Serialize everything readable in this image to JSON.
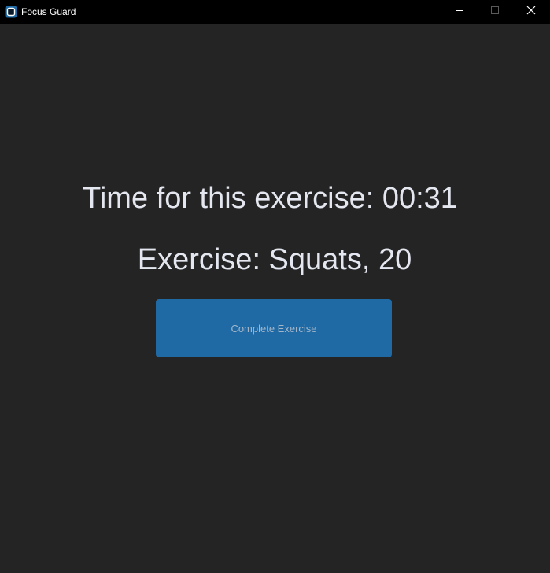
{
  "window": {
    "title": "Focus Guard",
    "app_icon": "focus-guard-app-icon",
    "controls": {
      "minimize_icon": "minimize-icon",
      "maximize_icon": "maximize-icon",
      "close_icon": "close-icon"
    }
  },
  "main": {
    "timer_text": "Time for this exercise: 00:31",
    "exercise_text": "Exercise: Squats, 20",
    "complete_button_label": "Complete Exercise"
  },
  "colors": {
    "background": "#242424",
    "titlebar": "#000000",
    "text": "#e4e7ef",
    "button": "#1f6aa5",
    "button_text": "#a4b6c8"
  }
}
